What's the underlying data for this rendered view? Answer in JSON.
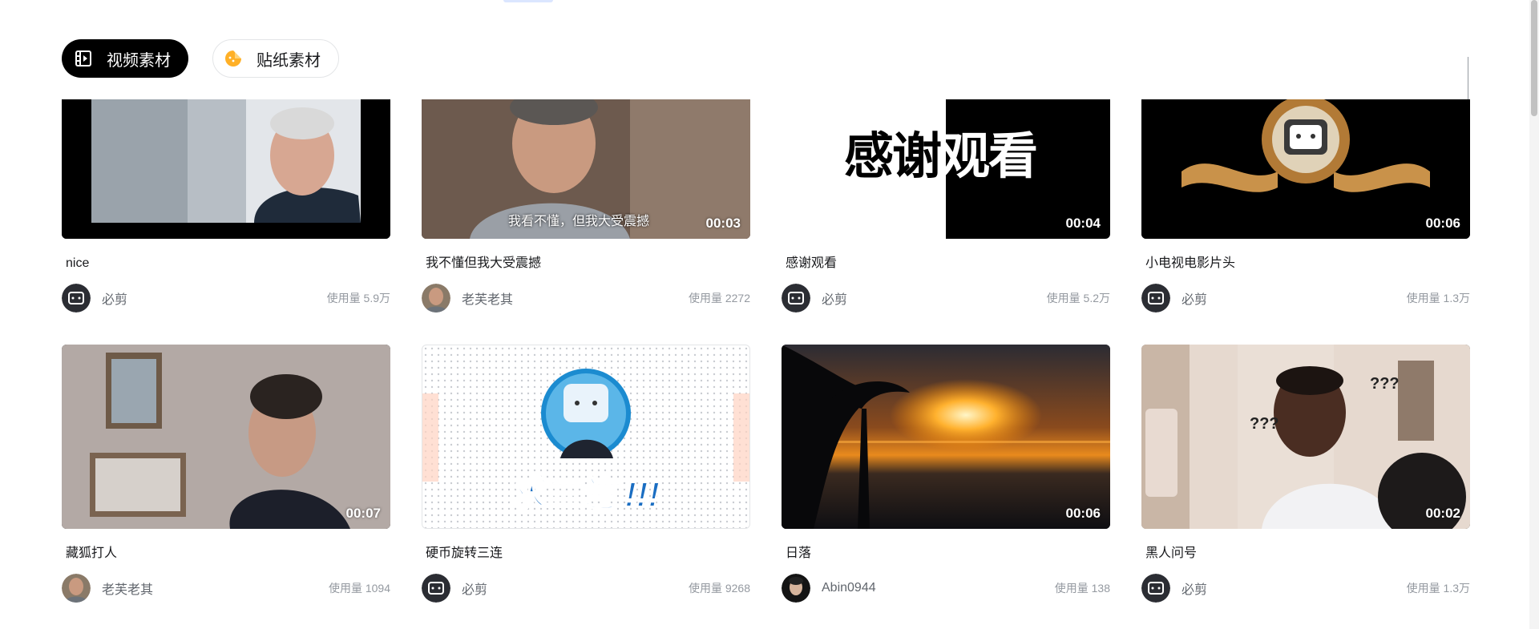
{
  "tabs": [
    {
      "label": "视频素材",
      "icon": "film-icon",
      "active": true
    },
    {
      "label": "贴纸素材",
      "icon": "sticker-icon",
      "active": false
    }
  ],
  "usage_prefix": "使用量",
  "cards": [
    {
      "title": "nice",
      "duration": "",
      "author": "必剪",
      "usage": "使用量 5.9万"
    },
    {
      "title": "我不懂但我大受震撼",
      "duration": "00:03",
      "author": "老芙老其",
      "usage": "使用量 2272",
      "subtitle": "我看不懂，但我大受震撼"
    },
    {
      "title": "感谢观看",
      "duration": "00:04",
      "author": "必剪",
      "usage": "使用量 5.2万",
      "overlay_text": "感谢观看"
    },
    {
      "title": "小电视电影片头",
      "duration": "00:06",
      "author": "必剪",
      "usage": "使用量 1.3万"
    },
    {
      "title": "藏狐打人",
      "duration": "00:07",
      "author": "老芙老其",
      "usage": "使用量 1094"
    },
    {
      "title": "硬币旋转三连",
      "duration": "",
      "author": "必剪",
      "usage": "使用量 9268",
      "overlay_text": "求三连 !!!"
    },
    {
      "title": "日落",
      "duration": "00:06",
      "author": "Abin0944",
      "usage": "使用量 138"
    },
    {
      "title": "黑人问号",
      "duration": "00:02",
      "author": "必剪",
      "usage": "使用量 1.3万",
      "overlay_text": "???"
    }
  ]
}
